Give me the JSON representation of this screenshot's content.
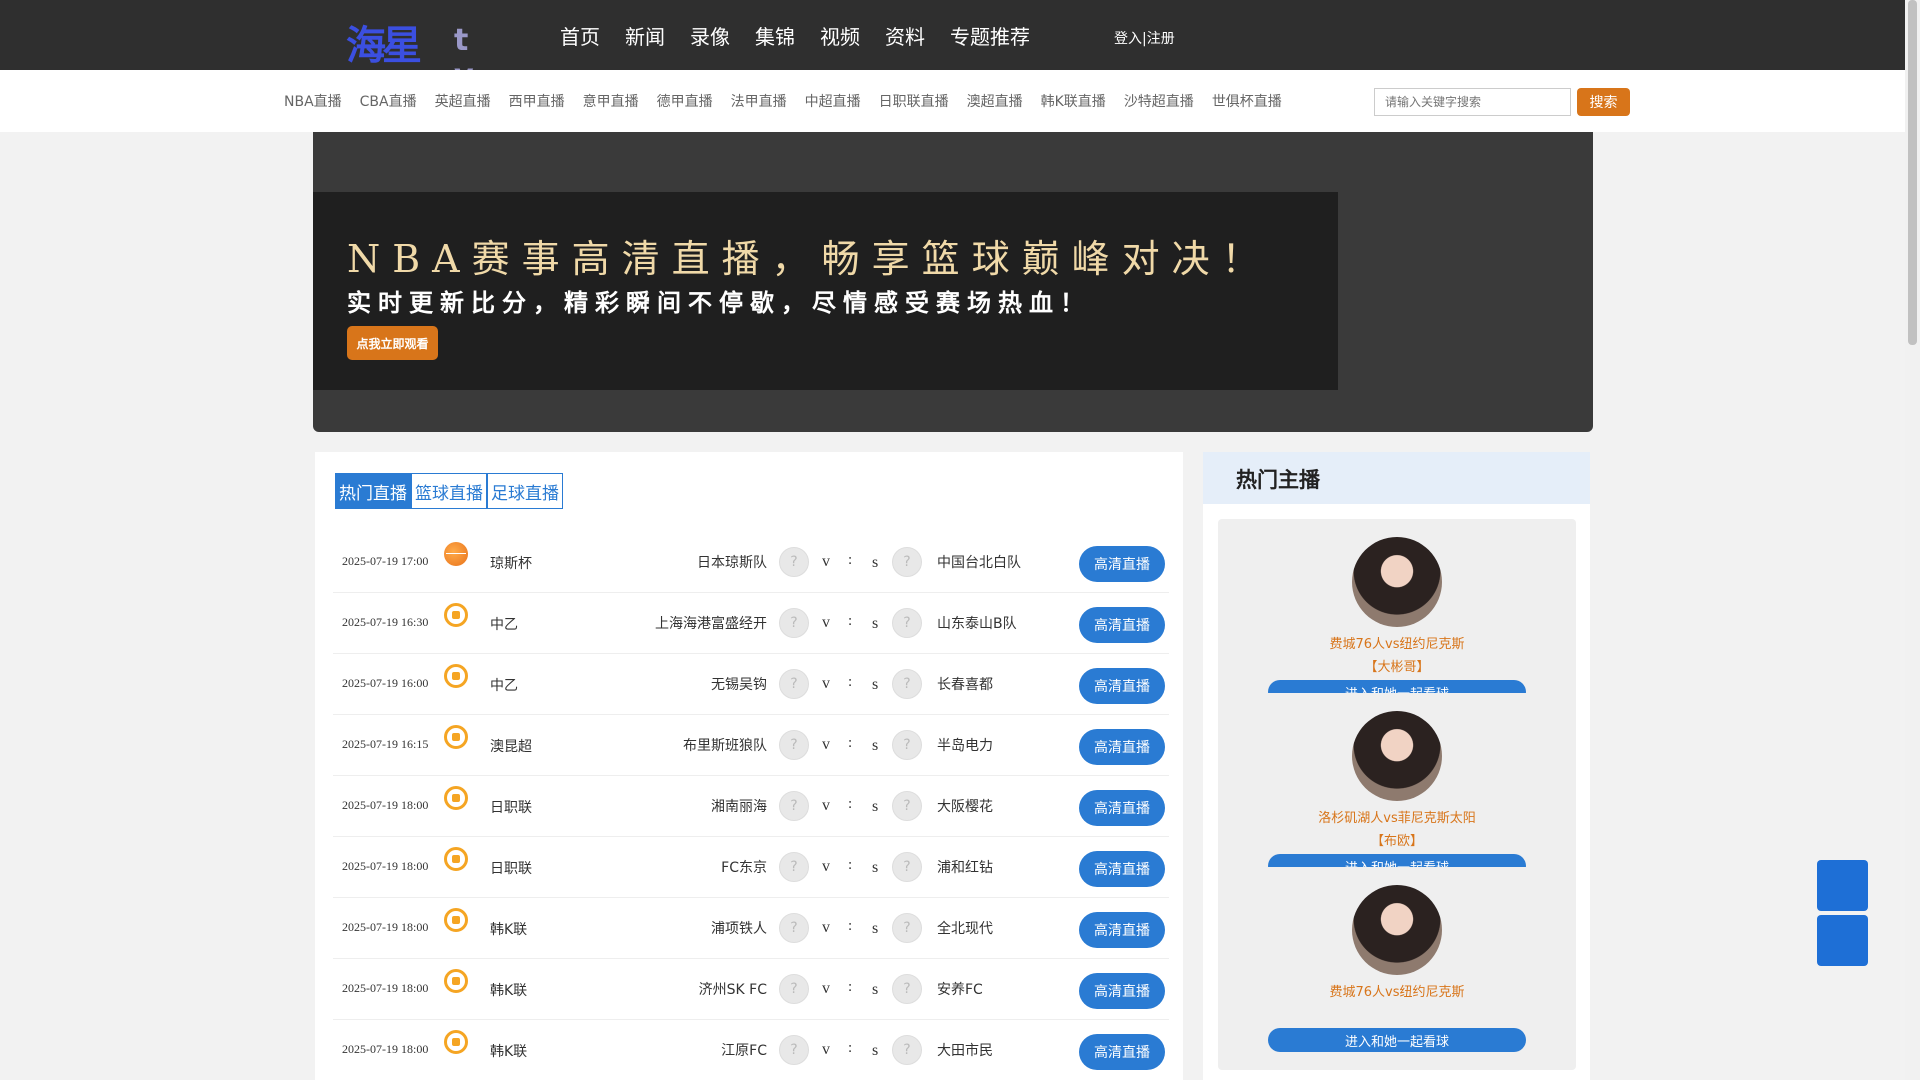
{
  "header": {
    "logo_text": "海星",
    "logo_mark": "t v",
    "nav": [
      "首页",
      "新闻",
      "录像",
      "集锦",
      "视频",
      "资料",
      "专题推荐"
    ],
    "login": "登入|注册"
  },
  "subnav": {
    "links": [
      "NBA直播",
      "CBA直播",
      "英超直播",
      "西甲直播",
      "意甲直播",
      "德甲直播",
      "法甲直播",
      "中超直播",
      "日职联直播",
      "澳超直播",
      "韩K联直播",
      "沙特超直播",
      "世俱杯直播"
    ],
    "search_placeholder": "请输入关键字搜索",
    "search_button": "搜索"
  },
  "banner": {
    "headline": "NBA赛事高清直播，畅享篮球巅峰对决！",
    "subline": "实时更新比分，精彩瞬间不停歇，尽情感受赛场热血！",
    "button": "点我立即观看"
  },
  "schedule": {
    "tabs": [
      "热门直播",
      "篮球直播",
      "足球直播"
    ],
    "active_tab": 0,
    "vs_text": "v",
    "colon_text": ":",
    "s_text": "s",
    "watch_label": "高清直播",
    "matches": [
      {
        "time": "2025-07-19 17:00",
        "sport": "basketball",
        "league": "琼斯杯",
        "home": "日本琼斯队",
        "away": "中国台北白队"
      },
      {
        "time": "2025-07-19 16:30",
        "sport": "soccer",
        "league": "中乙",
        "home": "上海海港富盛经开",
        "away": "山东泰山B队"
      },
      {
        "time": "2025-07-19 16:00",
        "sport": "soccer",
        "league": "中乙",
        "home": "无锡吴钩",
        "away": "长春喜都"
      },
      {
        "time": "2025-07-19 16:15",
        "sport": "soccer",
        "league": "澳昆超",
        "home": "布里斯班狼队",
        "away": "半岛电力"
      },
      {
        "time": "2025-07-19 18:00",
        "sport": "soccer",
        "league": "日职联",
        "home": "湘南丽海",
        "away": "大阪樱花"
      },
      {
        "time": "2025-07-19 18:00",
        "sport": "soccer",
        "league": "日职联",
        "home": "FC东京",
        "away": "浦和红钻"
      },
      {
        "time": "2025-07-19 18:00",
        "sport": "soccer",
        "league": "韩K联",
        "home": "浦项铁人",
        "away": "全北现代"
      },
      {
        "time": "2025-07-19 18:00",
        "sport": "soccer",
        "league": "韩K联",
        "home": "济州SK FC",
        "away": "安养FC"
      },
      {
        "time": "2025-07-19 18:00",
        "sport": "soccer",
        "league": "韩K联",
        "home": "江原FC",
        "away": "大田市民"
      }
    ]
  },
  "hosts": {
    "title": "热门主播",
    "join_label": "进入和她一起看球",
    "cards": [
      {
        "match": "费城76人vs纽约尼克斯",
        "name": "【大彬哥】"
      },
      {
        "match": "洛杉矶湖人vs菲尼克斯太阳",
        "name": "【布欧】"
      },
      {
        "match": "费城76人vs纽约尼克斯",
        "name": ""
      }
    ]
  },
  "colors": {
    "nav_bg": "#2f2f2f",
    "accent_orange": "#d8751a",
    "accent_blue": "#2a7bd3"
  }
}
